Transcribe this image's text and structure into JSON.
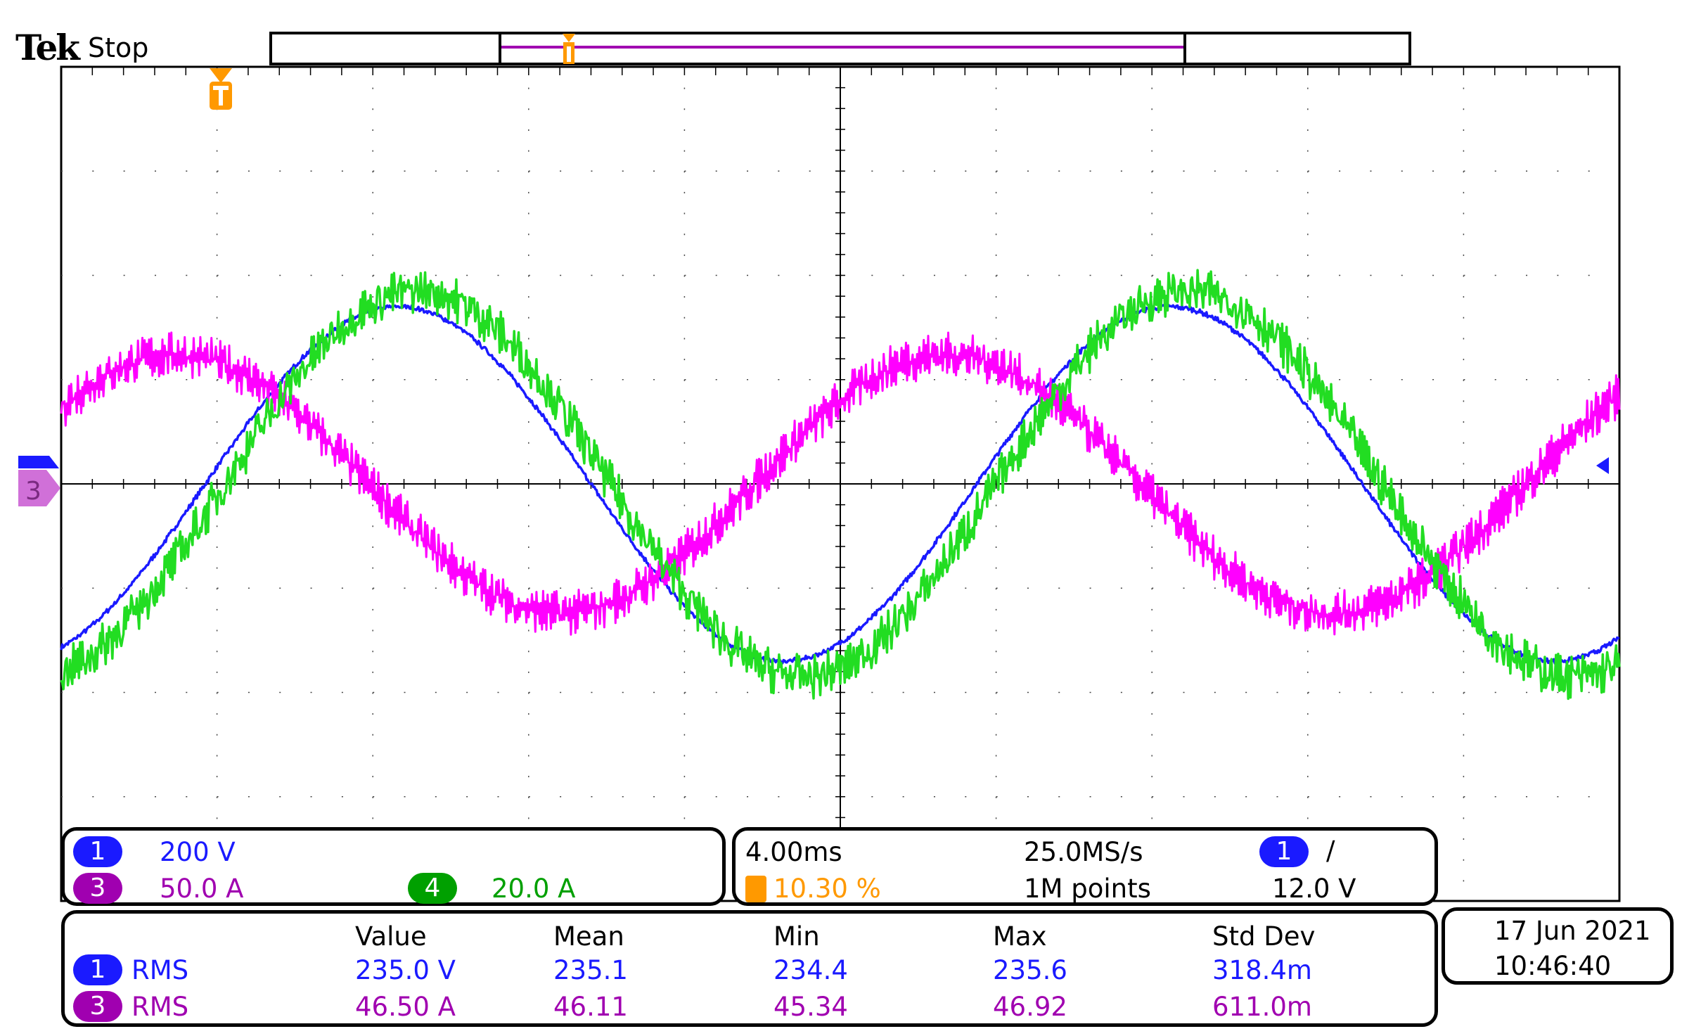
{
  "header": {
    "brand": "Tek",
    "status": "Stop"
  },
  "channels": [
    {
      "id": "1",
      "scale": "200 V",
      "color": "#1a1aff",
      "badge_color": "#1a1aff"
    },
    {
      "id": "3",
      "scale": "50.0 A",
      "color": "#a000b0",
      "badge_color": "#a000b0"
    },
    {
      "id": "4",
      "scale": "20.0 A",
      "color": "#00a000",
      "badge_color": "#00a000"
    }
  ],
  "timebase": {
    "time_per_div": "4.00ms",
    "sample_rate": "25.0MS/s",
    "trigger_position": "10.30 %",
    "record_length": "1M points",
    "trigger_source": "1",
    "trigger_slope": "/",
    "trigger_level": "12.0 V"
  },
  "measurements": {
    "headers": [
      "Value",
      "Mean",
      "Min",
      "Max",
      "Std Dev"
    ],
    "rows": [
      {
        "channel": "1",
        "type": "RMS",
        "value": "235.0 V",
        "mean": "235.1",
        "min": "234.4",
        "max": "235.6",
        "std": "318.4m"
      },
      {
        "channel": "3",
        "type": "RMS",
        "value": "46.50 A",
        "mean": "46.11",
        "min": "45.34",
        "max": "46.92",
        "std": "611.0m"
      }
    ]
  },
  "datetime": {
    "date": "17 Jun  2021",
    "time": "10:46:40"
  },
  "markers": {
    "trigger_icon": "T",
    "ch1_ground": "1",
    "ch3_ground": "3"
  },
  "chart_data": {
    "type": "line",
    "x_unit": "ms",
    "xlim": [
      0,
      40
    ],
    "divisions": {
      "x": 10,
      "y": 8
    },
    "grid": true,
    "series": [
      {
        "name": "CH1 voltage",
        "unit": "V",
        "volts_per_div": 200,
        "frequency_hz": 50.5,
        "amplitude": 340,
        "rising_zero_ms": 3.7,
        "noise": 4,
        "color": "#1a1aff"
      },
      {
        "name": "CH3 current",
        "unit": "A",
        "volts_per_div": 50,
        "frequency_hz": 50.5,
        "amplitude": 62,
        "rising_zero_ms": 17.8,
        "noise": 6,
        "color": "#ff00ff"
      },
      {
        "name": "CH4 current",
        "unit": "A",
        "volts_per_div": 20,
        "frequency_hz": 50.5,
        "amplitude": 37,
        "rising_zero_ms": 4.2,
        "noise": 3.5,
        "color": "#22dd22"
      }
    ]
  }
}
